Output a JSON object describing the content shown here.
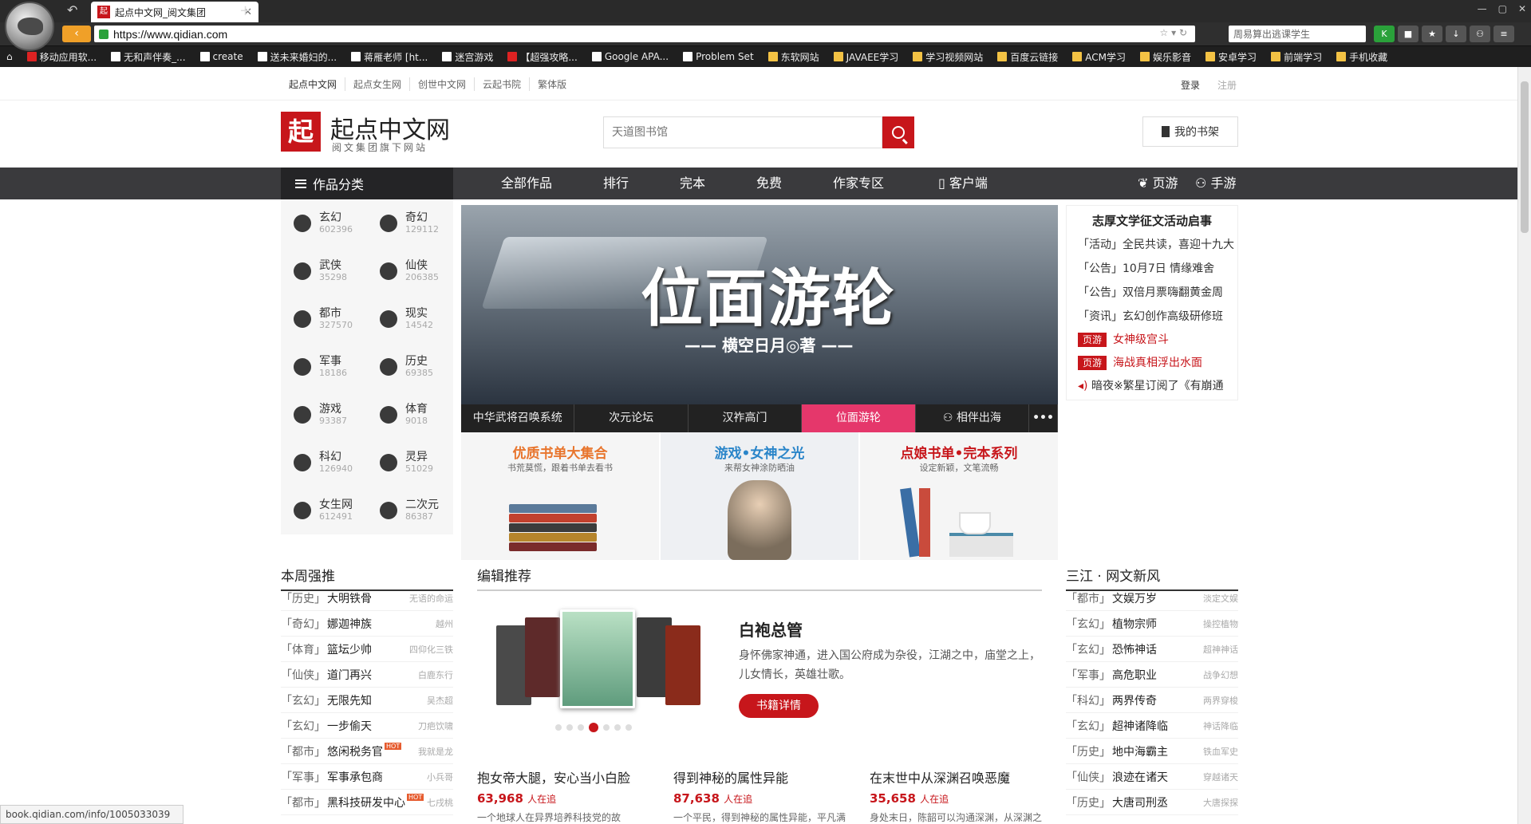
{
  "browser": {
    "tab_title": "起点中文网_阅文集团",
    "tab_favicon": "起",
    "url": "https://www.qidian.com",
    "search_box": "周易算出逃课学生",
    "bookmarks": [
      "移动应用软...",
      "无和声伴奏_...",
      "create",
      "送未来婚妇的...",
      "蒋雁老师 [ht...",
      "迷宫游戏",
      "【超强攻略...",
      "Google APA...",
      "Problem Set",
      "东软网站",
      "JAVAEE学习",
      "学习视频网站",
      "百度云链接",
      "ACM学习",
      "娱乐影音",
      "安卓学习",
      "前端学习",
      "手机收藏"
    ],
    "status_url": "book.qidian.com/info/1005033039"
  },
  "topnav": {
    "links": [
      "起点中文网",
      "起点女生网",
      "创世中文网",
      "云起书院",
      "繁体版"
    ],
    "login": "登录",
    "register": "注册"
  },
  "header": {
    "badge": "起",
    "title": "起点中文网",
    "subtitle": "阅文集团旗下网站",
    "search_placeholder": "天道图书馆",
    "shelf": "我的书架"
  },
  "mainnav": {
    "category": "作品分类",
    "links": [
      "全部作品",
      "排行",
      "完本",
      "免费",
      "作家专区",
      "客户端"
    ],
    "right": [
      "页游",
      "手游"
    ]
  },
  "categories": [
    {
      "name": "玄幻",
      "count": "602396"
    },
    {
      "name": "奇幻",
      "count": "129112"
    },
    {
      "name": "武侠",
      "count": "35298"
    },
    {
      "name": "仙侠",
      "count": "206385"
    },
    {
      "name": "都市",
      "count": "327570"
    },
    {
      "name": "现实",
      "count": "14542"
    },
    {
      "name": "军事",
      "count": "18186"
    },
    {
      "name": "历史",
      "count": "69385"
    },
    {
      "name": "游戏",
      "count": "93387"
    },
    {
      "name": "体育",
      "count": "9018"
    },
    {
      "name": "科幻",
      "count": "126940"
    },
    {
      "name": "灵异",
      "count": "51029"
    },
    {
      "name": "女生网",
      "count": "612491"
    },
    {
      "name": "二次元",
      "count": "86387"
    }
  ],
  "banner": {
    "title": "位面游轮",
    "author": "—— 横空日月◎著 ——",
    "tabs": [
      "中华武将召唤系统",
      "次元论坛",
      "汉祚高门",
      "位面游轮",
      "相伴出海",
      "•••"
    ]
  },
  "promos": [
    {
      "title": "优质书单大集合",
      "sub": "书荒莫慌，跟着书单去看书",
      "color": "#e8752d"
    },
    {
      "title": "游戏•女神之光",
      "sub": "来帮女神涂防晒油",
      "color": "#2a85c9"
    },
    {
      "title": "点娘书单•完本系列",
      "sub": "设定新颖，文笔流畅",
      "color": "#c7161b"
    }
  ],
  "news": {
    "title": "志厚文学征文活动启事",
    "items": [
      "「活动」全民共读，喜迎十九大",
      "「公告」10月7日  情缘难舍",
      "「公告」双倍月票嗨翻黄金周",
      "「资讯」玄幻创作高级研修班"
    ],
    "games": [
      {
        "tag": "页游",
        "text": "女神级宫斗"
      },
      {
        "tag": "页游",
        "text": "海战真相浮出水面"
      }
    ],
    "notice": "暗夜※繁星订阅了《有崩通"
  },
  "weekly": {
    "title": "本周强推",
    "rows": [
      {
        "cat": "「历史」",
        "name": "大明铁骨",
        "author": "无语的命运"
      },
      {
        "cat": "「奇幻」",
        "name": "娜迦神族",
        "author": "越州"
      },
      {
        "cat": "「体育」",
        "name": "篮坛少帅",
        "author": "四仰化三铁"
      },
      {
        "cat": "「仙侠」",
        "name": "道门再兴",
        "author": "白鹿东行"
      },
      {
        "cat": "「玄幻」",
        "name": "无限先知",
        "author": "吴杰超"
      },
      {
        "cat": "「玄幻」",
        "name": "一步偷天",
        "author": "刀疤饮啸"
      },
      {
        "cat": "「都市」",
        "name": "悠闲税务官",
        "author": "我就是龙"
      },
      {
        "cat": "「军事」",
        "name": "军事承包商",
        "author": "小兵哥"
      },
      {
        "cat": "「都市」",
        "name": "黑科技研发中心",
        "author": "七戌桃"
      }
    ]
  },
  "editor": {
    "title": "编辑推荐",
    "book": "白袍总管",
    "desc": "身怀佛家神通，进入国公府成为杂役，江湖之中，庙堂之上，儿女情长，英雄壮歌。",
    "button": "书籍详情",
    "features": [
      {
        "title": "抱女帝大腿，安心当小白脸",
        "count": "63,968",
        "unit": "人在追",
        "desc": "一个地球人在异界培养科技党的故"
      },
      {
        "title": "得到神秘的属性异能",
        "count": "87,638",
        "unit": "人在追",
        "desc": "一个平民，得到神秘的属性异能，平凡满"
      },
      {
        "title": "在末世中从深渊召唤恶魔",
        "count": "35,658",
        "unit": "人在追",
        "desc": "身处末日，陈韶可以沟通深渊，从深渊之"
      }
    ]
  },
  "sanjiang": {
    "title": "三江 · 网文新风",
    "rows": [
      {
        "cat": "「都市」",
        "name": "文娱万岁",
        "author": "淡定文娱"
      },
      {
        "cat": "「玄幻」",
        "name": "植物宗师",
        "author": "操控植物"
      },
      {
        "cat": "「玄幻」",
        "name": "恐怖神话",
        "author": "超神神话"
      },
      {
        "cat": "「军事」",
        "name": "高危职业",
        "author": "战争幻想"
      },
      {
        "cat": "「科幻」",
        "name": "两界传奇",
        "author": "两界穿梭"
      },
      {
        "cat": "「玄幻」",
        "name": "超神诸降临",
        "author": "神话降临"
      },
      {
        "cat": "「历史」",
        "name": "地中海霸主",
        "author": "铁血军史"
      },
      {
        "cat": "「仙侠」",
        "name": "浪迹在诸天",
        "author": "穿越诸天"
      },
      {
        "cat": "「历史」",
        "name": "大唐司刑丞",
        "author": "大唐探探"
      }
    ]
  }
}
